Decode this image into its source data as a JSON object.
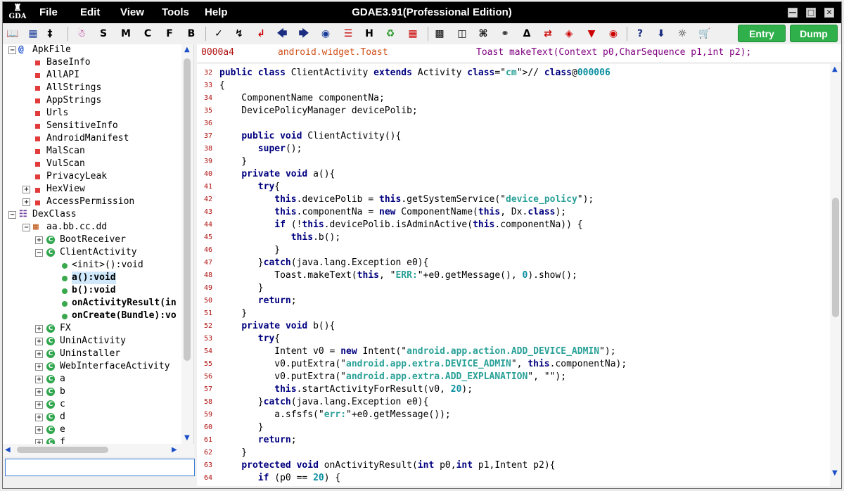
{
  "app": {
    "logo_text": "GDA",
    "title": "GDAE3.91(Professional Edition)"
  },
  "menu": [
    "File",
    "Edit",
    "View",
    "Tools",
    "Help"
  ],
  "toolbar": {
    "entry_label": "Entry",
    "dump_label": "Dump",
    "letters": [
      "S",
      "M",
      "C",
      "F",
      "B"
    ],
    "h_label": "H",
    "help_label": "?"
  },
  "tree": {
    "root": "ApkFile",
    "apk_items": [
      "BaseInfo",
      "AllAPI",
      "AllStrings",
      "AppStrings",
      "Urls",
      "SensitiveInfo",
      "AndroidManifest",
      "MalScan",
      "VulScan",
      "PrivacyLeak"
    ],
    "hexview": "HexView",
    "accesspermission": "AccessPermission",
    "dexclass": "DexClass",
    "package": "aa.bb.cc.dd",
    "classes_before": [
      "BootReceiver"
    ],
    "open_class": "ClientActivity",
    "methods": [
      "<init>():void",
      "a():void",
      "b():void",
      "onActivityResult(in",
      "onCreate(Bundle):vo"
    ],
    "classes_after": [
      "FX",
      "UninActivity",
      "Uninstaller",
      "WebInterfaceActivity",
      "a",
      "b",
      "c",
      "d",
      "e",
      "f"
    ]
  },
  "infobar": {
    "offset": "0000a4",
    "class": "android.widget.Toast",
    "signature": "Toast makeText(Context p0,CharSequence p1,int p2);"
  },
  "code_lines": [
    {
      "n": "32",
      "t": "public class ClientActivity extends Activity // class@000006"
    },
    {
      "n": "33",
      "t": "{"
    },
    {
      "n": "34",
      "t": "    ComponentName componentNa;"
    },
    {
      "n": "35",
      "t": "    DevicePolicyManager devicePolib;"
    },
    {
      "n": "36",
      "t": ""
    },
    {
      "n": "37",
      "t": "    public void ClientActivity(){"
    },
    {
      "n": "38",
      "t": "       super();"
    },
    {
      "n": "39",
      "t": "    }"
    },
    {
      "n": "40",
      "t": "    private void a(){"
    },
    {
      "n": "41",
      "t": "       try{"
    },
    {
      "n": "42",
      "t": "          this.devicePolib = this.getSystemService(\"device_policy\");"
    },
    {
      "n": "43",
      "t": "          this.componentNa = new ComponentName(this, Dx.class);"
    },
    {
      "n": "44",
      "t": "          if (!this.devicePolib.isAdminActive(this.componentNa)) {"
    },
    {
      "n": "45",
      "t": "             this.b();"
    },
    {
      "n": "46",
      "t": "          }"
    },
    {
      "n": "47",
      "t": "       }catch(java.lang.Exception e0){"
    },
    {
      "n": "48",
      "t": "          Toast.makeText(this, \"ERR:\"+e0.getMessage(), 0).show();"
    },
    {
      "n": "49",
      "t": "       }"
    },
    {
      "n": "50",
      "t": "       return;"
    },
    {
      "n": "51",
      "t": "    }"
    },
    {
      "n": "52",
      "t": "    private void b(){"
    },
    {
      "n": "53",
      "t": "       try{"
    },
    {
      "n": "54",
      "t": "          Intent v0 = new Intent(\"android.app.action.ADD_DEVICE_ADMIN\");"
    },
    {
      "n": "55",
      "t": "          v0.putExtra(\"android.app.extra.DEVICE_ADMIN\", this.componentNa);"
    },
    {
      "n": "56",
      "t": "          v0.putExtra(\"android.app.extra.ADD_EXPLANATION\", \"\");"
    },
    {
      "n": "57",
      "t": "          this.startActivityForResult(v0, 20);"
    },
    {
      "n": "58",
      "t": "       }catch(java.lang.Exception e0){"
    },
    {
      "n": "59",
      "t": "          a.sfsfs(\"err:\"+e0.getMessage());"
    },
    {
      "n": "60",
      "t": "       }"
    },
    {
      "n": "61",
      "t": "       return;"
    },
    {
      "n": "62",
      "t": "    }"
    },
    {
      "n": "63",
      "t": "    protected void onActivityResult(int p0,int p1,Intent p2){"
    },
    {
      "n": "64",
      "t": "       if (p0 == 20) {"
    }
  ]
}
